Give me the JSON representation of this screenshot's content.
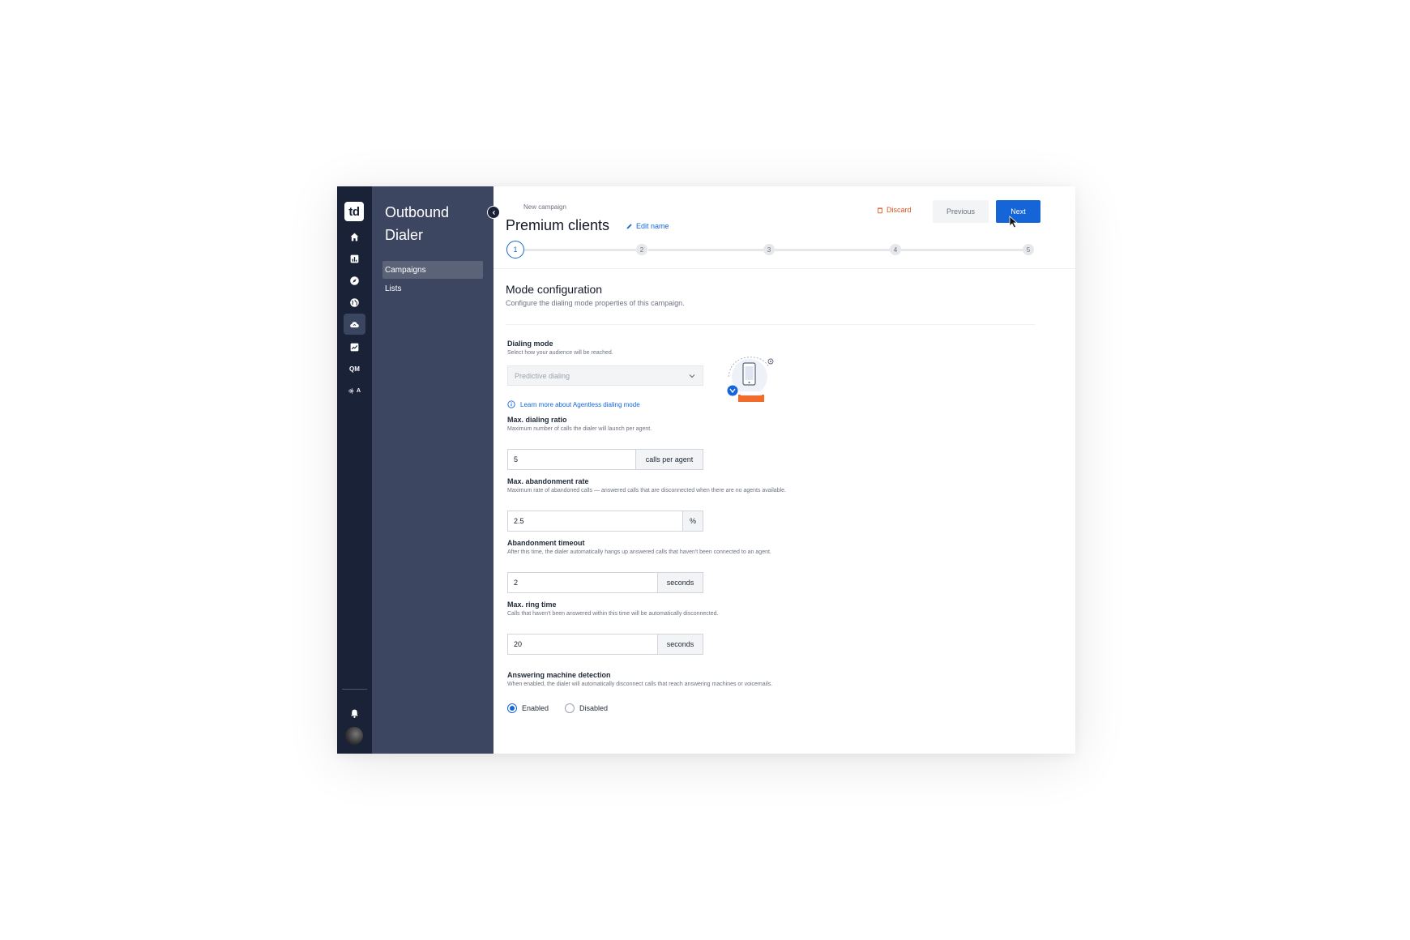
{
  "brand": {
    "logo_text": "td",
    "app_title": "Outbound Dialer"
  },
  "rail": {
    "icons": [
      "home-icon",
      "reports-icon",
      "compass-icon",
      "globe-icon",
      "cloud-icon",
      "analytics-icon",
      "qm-icon",
      "voice-icon"
    ],
    "qm_label": "QM",
    "voice_label": "A",
    "active": "cloud-icon",
    "bottom_icons": [
      "bell-icon",
      "avatar"
    ]
  },
  "sidebar": {
    "items": [
      {
        "label": "Campaigns",
        "active": true
      },
      {
        "label": "Lists",
        "active": false
      }
    ]
  },
  "header": {
    "breadcrumb": "New campaign",
    "title": "Premium clients",
    "edit_name": "Edit name",
    "discard": "Discard",
    "previous": "Previous",
    "next": "Next"
  },
  "stepper": {
    "steps": [
      "1",
      "2",
      "3",
      "4",
      "5"
    ],
    "current": "1"
  },
  "section": {
    "title": "Mode configuration",
    "description": "Configure the dialing mode properties of this campaign."
  },
  "fields": {
    "dialing_mode": {
      "label": "Dialing mode",
      "help": "Select how your audience will be reached.",
      "value": "Predictive dialing",
      "learn_more": "Learn more about Agentless dialing mode"
    },
    "max_dialing_ratio": {
      "label": "Max. dialing ratio",
      "help": "Maximum number of calls the dialer will launch per agent.",
      "value": "5",
      "unit": "calls per agent"
    },
    "max_abandonment_rate": {
      "label": "Max. abandonment rate",
      "help": "Maximum rate of abandoned calls — answered calls that are disconnected when there are no agents available.",
      "value": "2.5",
      "unit": "%"
    },
    "abandonment_timeout": {
      "label": "Abandonment timeout",
      "help": "After this time, the dialer automatically hangs up answered calls that haven't been connected to an agent.",
      "value": "2",
      "unit": "seconds"
    },
    "max_ring_time": {
      "label": "Max. ring time",
      "help": "Calls that haven't been answered within this time will be automatically disconnected.",
      "value": "20",
      "unit": "seconds"
    },
    "amd": {
      "label": "Answering machine detection",
      "help": "When enabled, the dialer will automatically disconnect calls that reach answering machines or voicemails.",
      "options": [
        "Enabled",
        "Disabled"
      ],
      "selected": "Enabled"
    }
  },
  "colors": {
    "primary": "#1565d8",
    "danger": "#d9531e",
    "rail": "#1a2238",
    "sidebar": "#3d4660"
  }
}
